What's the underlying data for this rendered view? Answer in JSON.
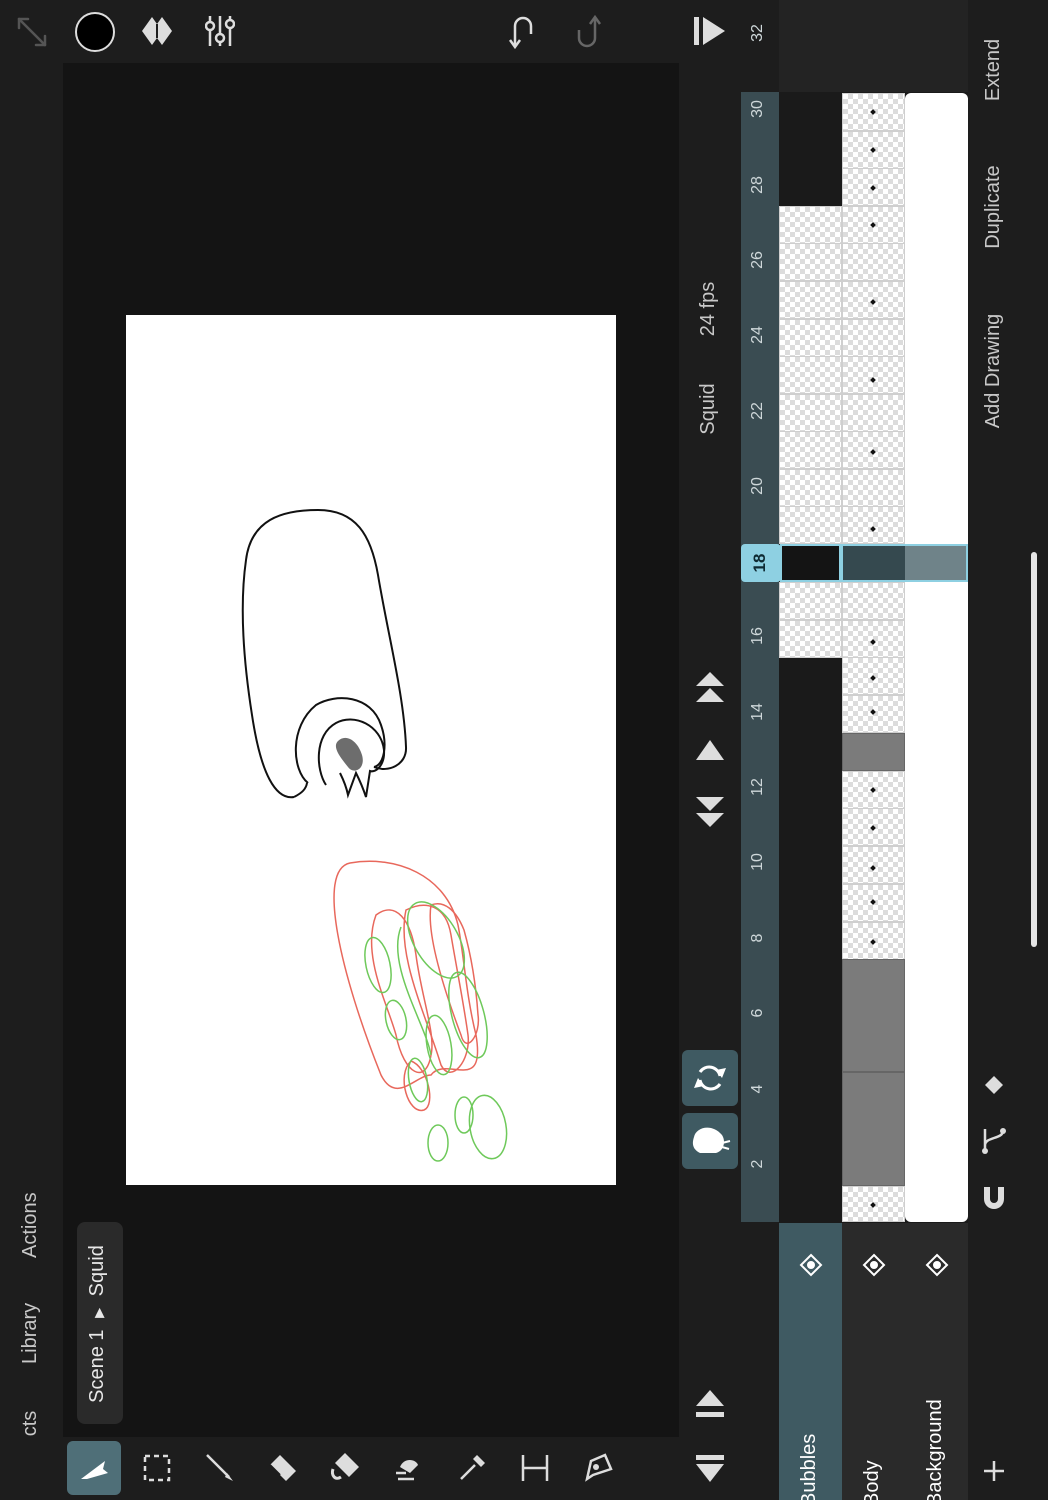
{
  "left_tabs": {
    "projects": "Projects",
    "library": "Library",
    "actions": "Actions"
  },
  "breadcrumb": {
    "scene": "Scene 1",
    "separator": "▶",
    "item": "Squid"
  },
  "project": {
    "name": "Squid",
    "fps": "24 fps"
  },
  "frame_ruler": {
    "current": "18",
    "labels": [
      "2",
      "4",
      "6",
      "8",
      "10",
      "12",
      "14",
      "16",
      "20",
      "22",
      "24",
      "26",
      "28",
      "30",
      "32"
    ]
  },
  "layers": [
    {
      "label": "Bubbles",
      "selected": true
    },
    {
      "label": "Body",
      "selected": false
    },
    {
      "label": "Background",
      "selected": false
    }
  ],
  "timeline_actions": {
    "extend": "Extend",
    "duplicate": "Duplicate",
    "add_drawing": "Add Drawing"
  },
  "colors": {
    "accent": "#8ed0e2",
    "selected_layer": "#3f5a62",
    "onion_prev": "#e8685c",
    "onion_next": "#6ec95a",
    "current_color": "#000000"
  },
  "icons": {
    "top_left": [
      "expand-icon",
      "color-swatch-icon",
      "brush-shape-icon",
      "brush-settings-icon"
    ],
    "top_center": [
      "undo-icon",
      "redo-icon",
      "play-icon"
    ],
    "tools": [
      "select-arrow-icon",
      "marquee-icon",
      "brush-icon",
      "eraser-icon",
      "fill-icon",
      "smudge-icon",
      "eyedropper-icon",
      "measure-icon",
      "pen-tool-icon"
    ],
    "playback": [
      "loop-icon",
      "onion-skin-icon",
      "next-keyframe-icon",
      "next-frame-icon",
      "prev-keyframe-icon",
      "prev-frame-icon",
      "collapse-icon",
      "expand-timeline-icon"
    ],
    "timeline_bottom": [
      "add-layer-icon",
      "magnet-icon",
      "branch-icon",
      "keyframe-diamond-icon"
    ]
  }
}
